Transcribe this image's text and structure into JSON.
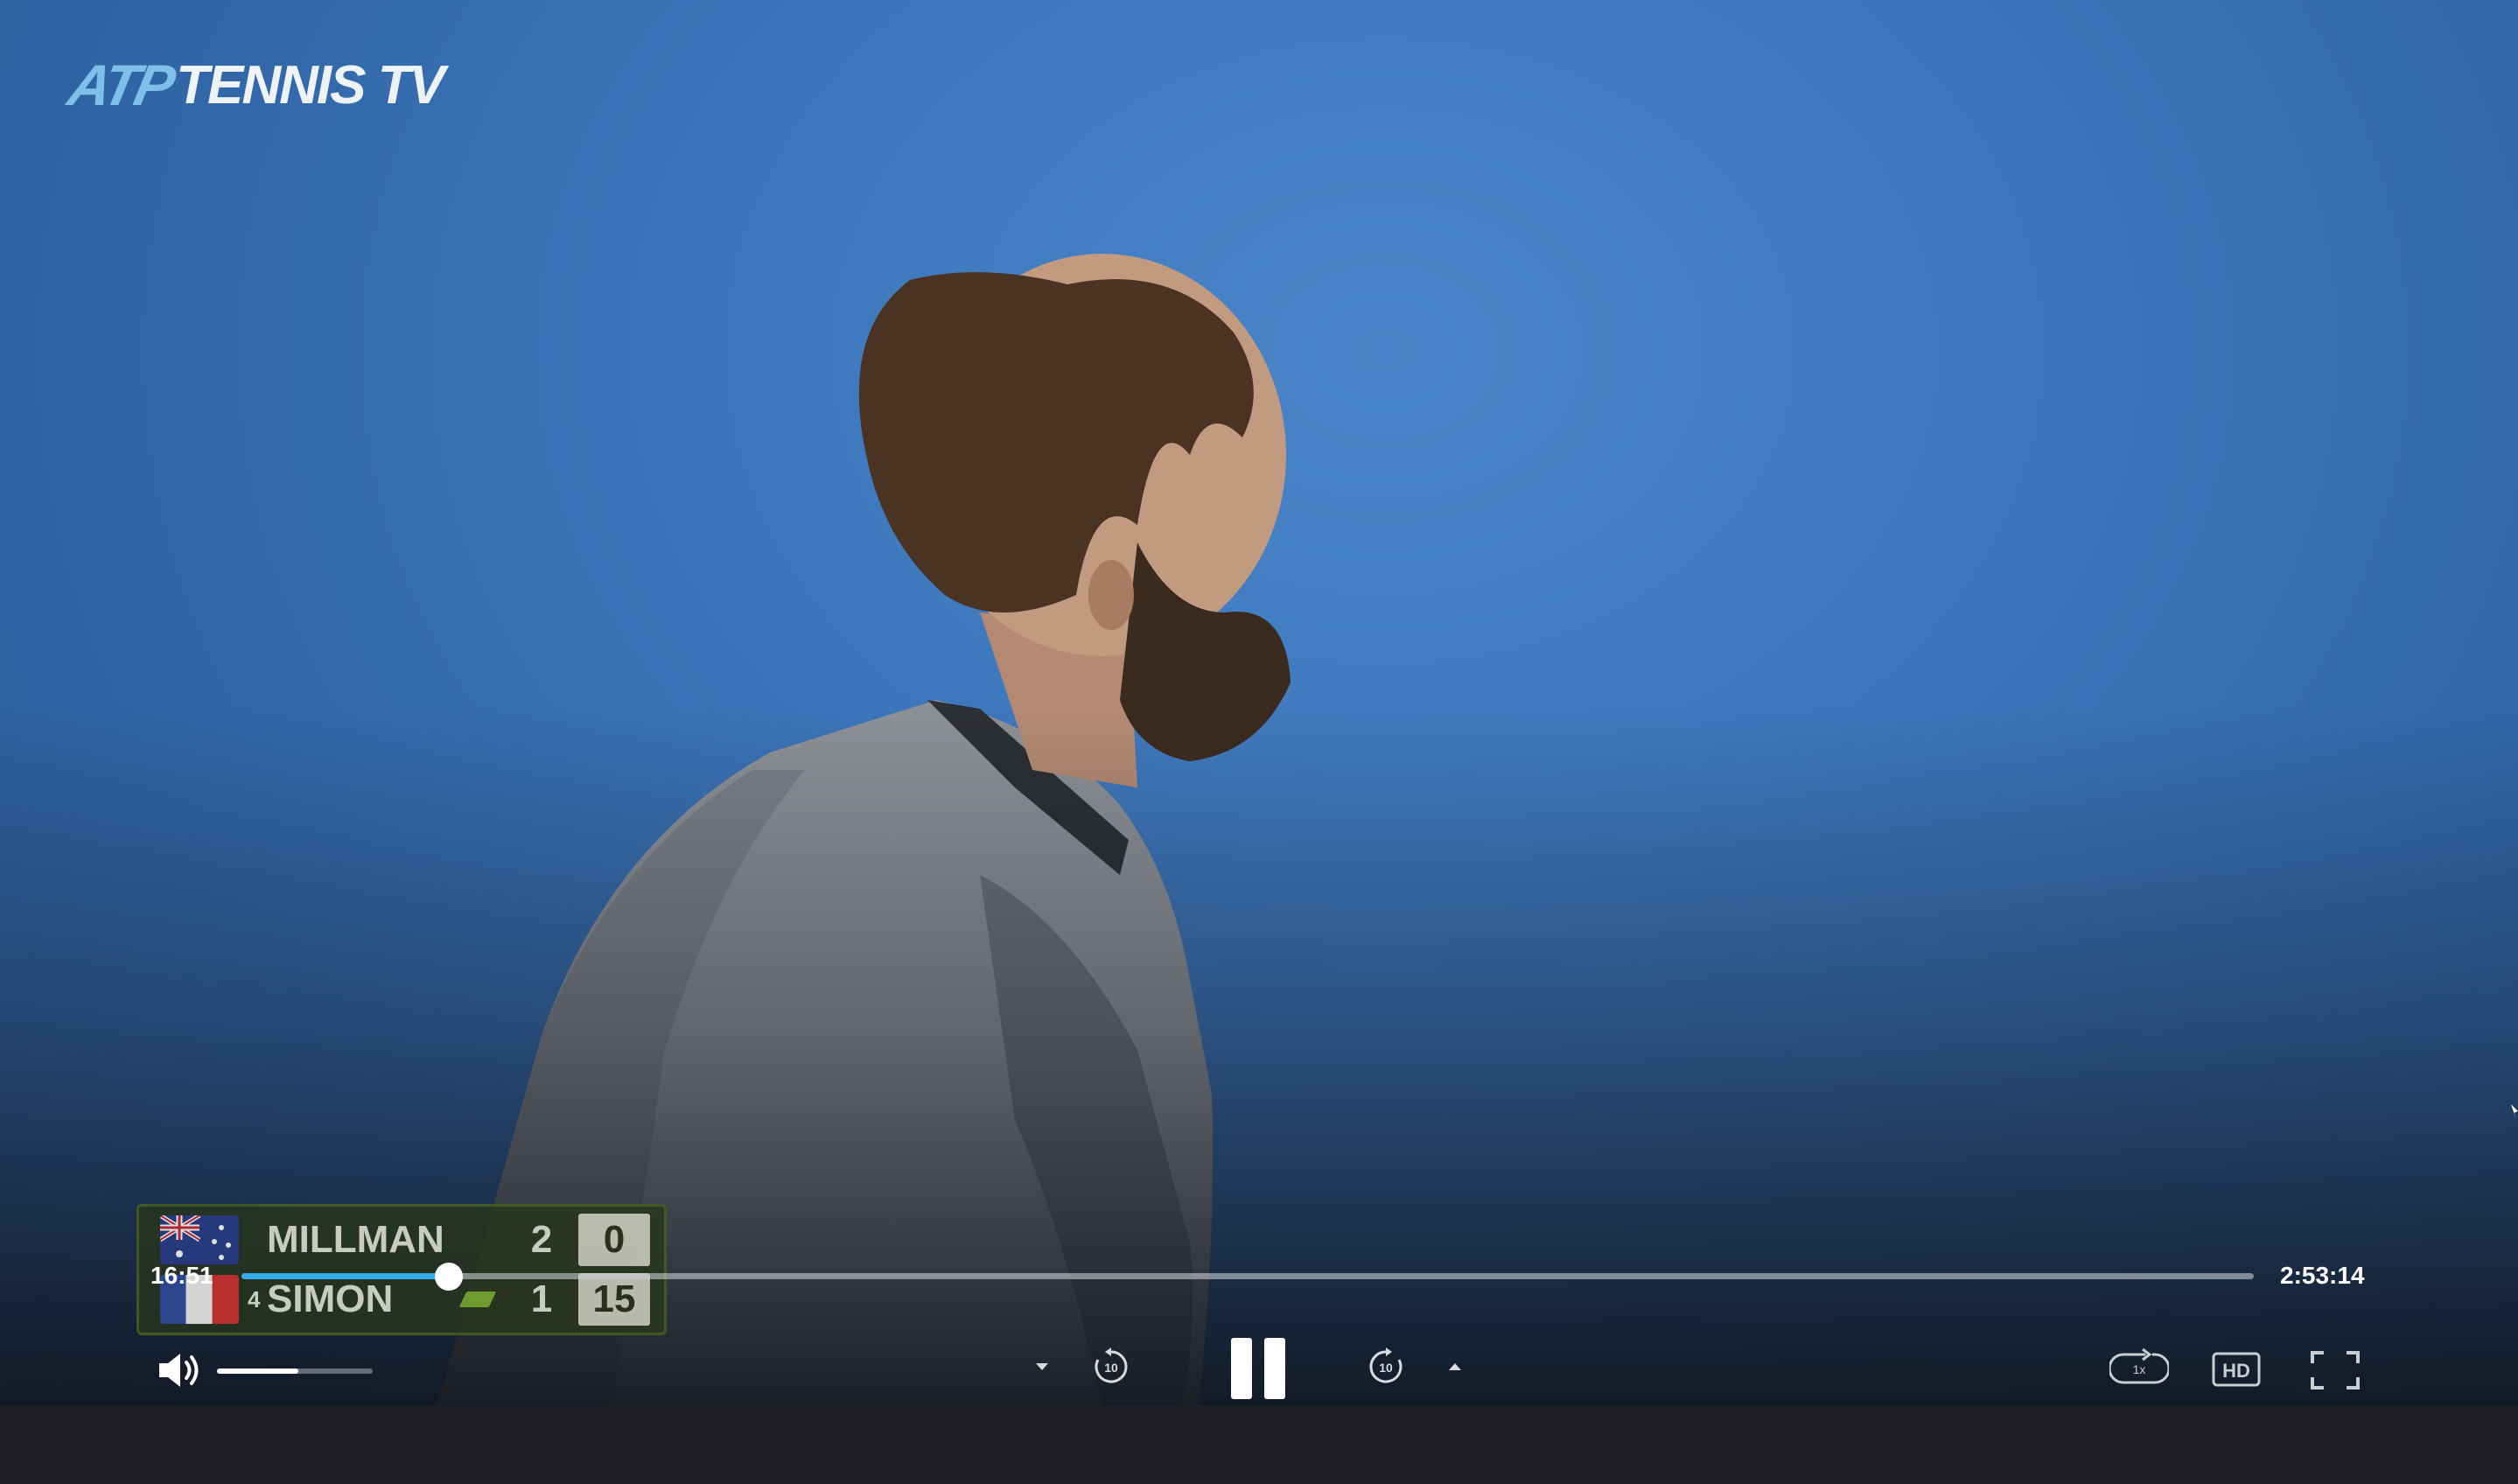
{
  "app": {
    "logo_text_atp": "ATP",
    "logo_text_tennis_tv": "TENNIS TV",
    "accent_color": "#36a9e8"
  },
  "scoreboard": {
    "players": [
      {
        "name": "MILLMAN",
        "seed": "",
        "flag": "australia-flag",
        "sets": "2",
        "points": "0",
        "serving": false
      },
      {
        "name": "SIMON",
        "seed": "4",
        "flag": "france-flag",
        "sets": "1",
        "points": "15",
        "serving": true
      }
    ]
  },
  "player_controls": {
    "current_time": "16:51",
    "total_time": "2:53:14",
    "progress_fraction": 0.103,
    "volume_fraction": 0.52,
    "skip_back_label": "10",
    "skip_forward_label": "10",
    "speed_label": "1x",
    "quality_label": "HD",
    "icons": {
      "volume": "volume-icon",
      "skip_back_menu": "chevron-down-icon",
      "skip_back": "rewind-10-icon",
      "play_pause": "pause-icon",
      "skip_forward": "forward-10-icon",
      "skip_forward_menu": "chevron-up-icon",
      "speed": "playback-speed-icon",
      "quality": "hd-icon",
      "fullscreen": "fullscreen-icon"
    }
  }
}
